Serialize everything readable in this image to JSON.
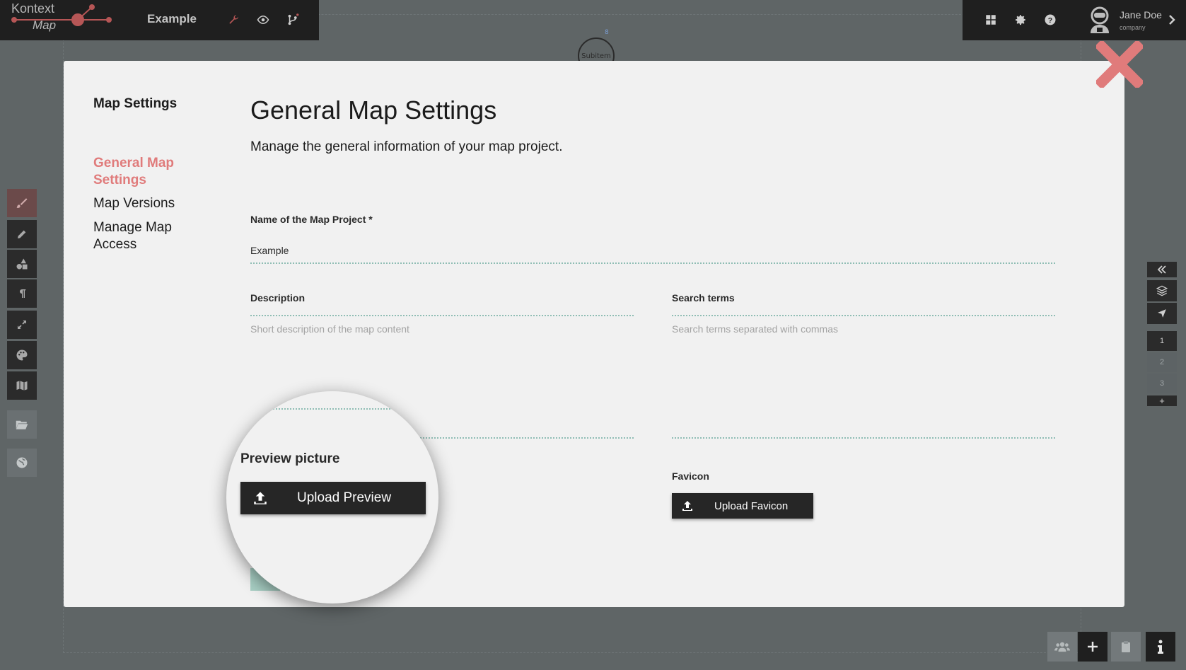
{
  "app": {
    "logo_line1": "Kontext",
    "logo_line2": "Map",
    "map_title": "Example"
  },
  "user": {
    "name": "Jane Doe",
    "company": "company"
  },
  "canvas": {
    "node_label": "Subitem",
    "node_badge": "8"
  },
  "right_toolbar": {
    "pages": [
      "1",
      "2",
      "3"
    ],
    "add": "+"
  },
  "modal": {
    "sidebar": {
      "title": "Map Settings",
      "items": [
        "General Map Settings",
        "Map Versions",
        "Manage Map Access"
      ],
      "active_index": 0
    },
    "title": "General Map Settings",
    "subtitle": "Manage the general information of your map project.",
    "fields": {
      "name": {
        "label": "Name of the Map Project *",
        "value": "Example"
      },
      "description": {
        "label": "Description",
        "placeholder": "Short description of the map content"
      },
      "search_terms": {
        "label": "Search terms",
        "placeholder": "Search terms separated with commas"
      },
      "preview": {
        "label": "Preview picture",
        "button": "Upload Preview"
      },
      "favicon": {
        "label": "Favicon",
        "button": "Upload Favicon"
      }
    }
  },
  "colors": {
    "accent": "#e07b7b",
    "dark": "#1f1f1f",
    "dotted_line": "#8fbdb4",
    "close": "#e07b7b"
  }
}
